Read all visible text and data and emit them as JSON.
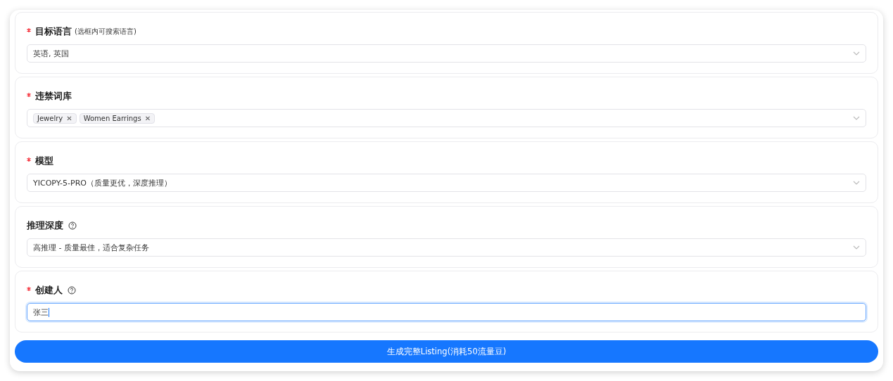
{
  "fields": [
    {
      "kind": "select",
      "label": "目标语言",
      "required": true,
      "hint": "(选框内可搜索语言)",
      "help": false,
      "value": "英语, 英国"
    },
    {
      "kind": "tags",
      "label": "违禁词库",
      "required": true,
      "help": false,
      "tags": [
        {
          "label": "Jewelry",
          "remove": "✕"
        },
        {
          "label": "Women Earrings",
          "remove": "✕"
        }
      ]
    },
    {
      "kind": "select",
      "label": "模型",
      "required": true,
      "help": false,
      "value": "YICOPY-5-PRO（质量更优，深度推理）"
    },
    {
      "kind": "select",
      "label": "推理深度",
      "required": false,
      "help": true,
      "value": "高推理 - 质量最佳，适合复杂任务"
    },
    {
      "kind": "input",
      "label": "创建人",
      "required": true,
      "help": true,
      "value": "张三",
      "focused": true
    }
  ],
  "submit": {
    "label": "生成完整Listing(消耗50流量豆)"
  }
}
